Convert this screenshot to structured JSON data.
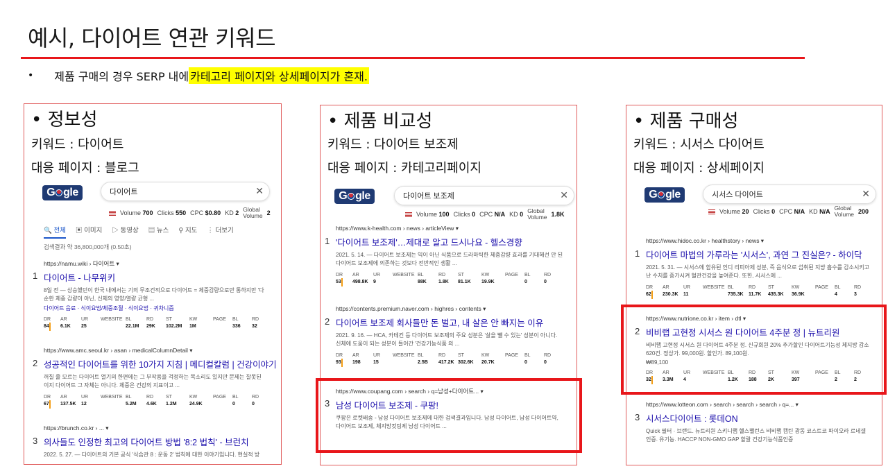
{
  "title": "예시, 다이어트 연관 키워드",
  "intro": {
    "bullet": "•",
    "prefix": "제품 구매의 경우 SERP 내에 ",
    "highlight": "카테고리 페이지와 상세페이지가 혼재."
  },
  "accent_color": "#e8161a",
  "panels": [
    {
      "heading": "• 정보성",
      "keyword_line": "키워드 : 다이어트",
      "page_line": "대응 페이지 : 블로그",
      "search": {
        "logo": "Gogle",
        "query": "다이어트",
        "close": "✕"
      },
      "metrics": {
        "volume_label": "Volume",
        "volume": "700",
        "clicks_label": "Clicks",
        "clicks": "550",
        "cpc_label": "CPC",
        "cpc": "$0.80",
        "kd_label": "KD",
        "kd": "2",
        "gv_label1": "Global",
        "gv_label2": "Volume",
        "gv": "2"
      },
      "tabs": [
        "전체",
        "이미지",
        "동영상",
        "뉴스",
        "지도",
        "더보기"
      ],
      "count": "검색결과 약 36,800,000개 (0.50초)",
      "results": [
        {
          "num": "1",
          "url": "https://namu.wiki › 다이어트  ▾",
          "title": "다이어트 - 나무위키",
          "snip1": "8일 전 — 상승했던이 한국 내에서는 기의 무조건적으로 다이어트 = 체중감량으로만 통하지만 '다",
          "snip2": "순한 체중 감량이 아닌, 신체의 영양/열량 균형 ...",
          "chips": "다이어트 음료 · 식이요법/체중조절 · 식이요법 · 귀차니즘",
          "stats": [
            [
              "DR",
              "84"
            ],
            [
              "AR",
              "6.1K"
            ],
            [
              "UR",
              "25"
            ],
            [
              "WEBSITE",
              ""
            ],
            [
              "BL",
              "22.1M"
            ],
            [
              "RD",
              "29K"
            ],
            [
              "ST",
              "102.2M"
            ],
            [
              "KW",
              "1M"
            ],
            [
              "PAGE",
              ""
            ],
            [
              "BL",
              "336"
            ],
            [
              "RD",
              "32"
            ]
          ]
        },
        {
          "num": "2",
          "url": "https://www.amc.seoul.kr › asan › medicalColumnDetail  ▾",
          "title": "성공적인 다이어트를 위한 10가지 지침 | 메디컬칼럼 | 건강이야기",
          "snip1": "꺼질 줄 모르는 다이어트 열기의 한편에는 그 부작용을 걱정하는 목소리도 있지만 문제는 잘못된",
          "snip2": "이지 다이어트 그 자체는 아니다. 체중은 건강의 지표이고 ...",
          "chips": "",
          "stats": [
            [
              "DR",
              "67"
            ],
            [
              "AR",
              "137.5K"
            ],
            [
              "UR",
              "12"
            ],
            [
              "WEBSITE",
              ""
            ],
            [
              "BL",
              "5.2M"
            ],
            [
              "RD",
              "4.6K"
            ],
            [
              "ST",
              "1.2M"
            ],
            [
              "KW",
              "24.9K"
            ],
            [
              "PAGE",
              ""
            ],
            [
              "BL",
              "0"
            ],
            [
              "RD",
              "0"
            ]
          ]
        },
        {
          "num": "3",
          "url": "https://brunch.co.kr › ...  ▾",
          "title": "의사들도 인정한 최고의 다이어트 방법 '8:2 법칙' - 브런치",
          "snip1": "2022. 5. 27. — 다이어트의 기본 공식 '식습관 8 : 운동 2' 법칙에 대한 이야기입니다. 현실적 방",
          "snip2": "",
          "chips": "",
          "stats": []
        }
      ]
    },
    {
      "heading": "• 제품 비교성",
      "keyword_line": "키워드 : 다이어트 보조제",
      "page_line": "대응 페이지 : 카테고리페이지",
      "search": {
        "logo": "Gogle",
        "query": "다이어트 보조제",
        "close": "✕"
      },
      "metrics": {
        "volume_label": "Volume",
        "volume": "100",
        "clicks_label": "Clicks",
        "clicks": "0",
        "cpc_label": "CPC",
        "cpc": "N/A",
        "kd_label": "KD",
        "kd": "0",
        "gv_label1": "Global",
        "gv_label2": "Volume",
        "gv": "1.8K"
      },
      "results": [
        {
          "num": "1",
          "url": "https://www.k-health.com › news › articleView  ▾",
          "title": "'다이어트 보조제'…제대로 알고 드시나요 - 헬스경향",
          "snip1": "2021. 5. 14. — 다이어트 보조제는 익이 아닌 식품으로 드라마틱한 체중감량 효과를 기대해선 안 된",
          "snip2": "다이어트 보조제에 의존하는 것보다 전반적인 생활 ...",
          "chips": "",
          "stats": [
            [
              "DR",
              "53"
            ],
            [
              "AR",
              "498.8K"
            ],
            [
              "UR",
              "9"
            ],
            [
              "WEBSITE",
              ""
            ],
            [
              "BL",
              "88K"
            ],
            [
              "RD",
              "1.8K"
            ],
            [
              "ST",
              "81.1K"
            ],
            [
              "KW",
              "19.9K"
            ],
            [
              "PAGE",
              ""
            ],
            [
              "BL",
              "0"
            ],
            [
              "RD",
              "0"
            ]
          ]
        },
        {
          "num": "2",
          "url": "https://contents.premium.naver.com › highres › contents  ▾",
          "title": "다이어트 보조제 회사들만 돈 벌고, 내 살은 안 빠지는 이유",
          "snip1": "2021. 9. 16. — HCA, 카테킨 등 다이어트 보조제의 주요 성분은 '살을 뺄 수 있는' 성분이 아니다.",
          "snip2": "신체에 도움이 되는 성분이 들어간 '건강기능식품 외 ...",
          "chips": "",
          "stats": [
            [
              "DR",
              "93"
            ],
            [
              "AR",
              "198"
            ],
            [
              "UR",
              "15"
            ],
            [
              "WEBSITE",
              ""
            ],
            [
              "BL",
              "2.5B"
            ],
            [
              "RD",
              "417.2K"
            ],
            [
              "ST",
              "302.6K"
            ],
            [
              "KW",
              "20.7K"
            ],
            [
              "PAGE",
              ""
            ],
            [
              "BL",
              "0"
            ],
            [
              "RD",
              "0"
            ]
          ]
        },
        {
          "num": "3",
          "url": "https://www.coupang.com › search › q=남성+다이어트...  ▾",
          "title": "남성 다이어트 보조제 - 쿠팡!",
          "snip1": "쿠팡은 로켓배송 - 남성 다이어트 보조제에 대한 검색결과입니다. 남성 다이어트, 남성 다이어트약,",
          "snip2": "다이어트 보조제, 체지방컷팅제 남성 다이어트 ...",
          "chips": "",
          "stats": []
        }
      ]
    },
    {
      "heading": "• 제품 구매성",
      "keyword_line": "키워드 : 시서스 다이어트",
      "page_line": "대응 페이지 : 상세페이지",
      "search": {
        "logo": "Gogle",
        "query": "시서스 다이어트",
        "close": "✕"
      },
      "metrics": {
        "volume_label": "Volume",
        "volume": "20",
        "clicks_label": "Clicks",
        "clicks": "0",
        "cpc_label": "CPC",
        "cpc": "N/A",
        "kd_label": "KD",
        "kd": "N/A",
        "gv_label1": "Global",
        "gv_label2": "Volume",
        "gv": "200"
      },
      "results": [
        {
          "num": "1",
          "url": "https://www.hidoc.co.kr › healthstory › news  ▾",
          "title": "다이어트 마법의 가루라는 '시서스', 과연 그 진실은? - 하이닥",
          "snip1": "2021. 5. 31. — 시서스에 함유된 인디 리피아제 성분, 즉 음식으로 섭취된 지방 흡수를 감소시키고",
          "snip2": "난 수치를 증가시켜 혈관건강을 높여준다. 또한, 시서스에 ...",
          "chips": "",
          "stats": [
            [
              "DR",
              "62"
            ],
            [
              "AR",
              "230.3K"
            ],
            [
              "UR",
              "11"
            ],
            [
              "WEBSITE",
              ""
            ],
            [
              "BL",
              "735.3K"
            ],
            [
              "RD",
              "11.7K"
            ],
            [
              "ST",
              "435.3K"
            ],
            [
              "KW",
              "36.9K"
            ],
            [
              "PAGE",
              ""
            ],
            [
              "BL",
              "4"
            ],
            [
              "RD",
              "3"
            ]
          ]
        },
        {
          "num": "2",
          "url": "https://www.nutrione.co.kr › item › dtl  ▾",
          "title": "비비랩 고현정 시서스 원 다이어트 4주분 정 | 뉴트리원",
          "snip1": "비비랩 고현정 시서스 원 다이어트 4주분 정. 신규회원 20% 추가할인 다이어트기능성 체지방 감소",
          "snip2": "620건. 정상가. 99,000원. 할인가. 89,100원.",
          "price": "₩89,100",
          "chips": "",
          "stats": [
            [
              "DR",
              "32"
            ],
            [
              "AR",
              "3.3M"
            ],
            [
              "UR",
              "4"
            ],
            [
              "WEBSITE",
              ""
            ],
            [
              "BL",
              "1.2K"
            ],
            [
              "RD",
              "188"
            ],
            [
              "ST",
              "2K"
            ],
            [
              "KW",
              "397"
            ],
            [
              "PAGE",
              ""
            ],
            [
              "BL",
              "2"
            ],
            [
              "RD",
              "2"
            ]
          ]
        },
        {
          "num": "3",
          "url": "https://www.lotteon.com › search › search › search › q=...  ▾",
          "title": "시서스다이어트 : 롯데ON",
          "snip1": "Quick 필터 · 브랜드. 뉴트리원 스키니랩 헬스밸런스 비비랩 캡틴 광동 코스트코 파이오라 르네셀",
          "snip2": "인증. 유기농. HACCP NON-GMO GAP 할랄 건강기능식품인증",
          "chips": "",
          "stats": []
        }
      ]
    }
  ]
}
